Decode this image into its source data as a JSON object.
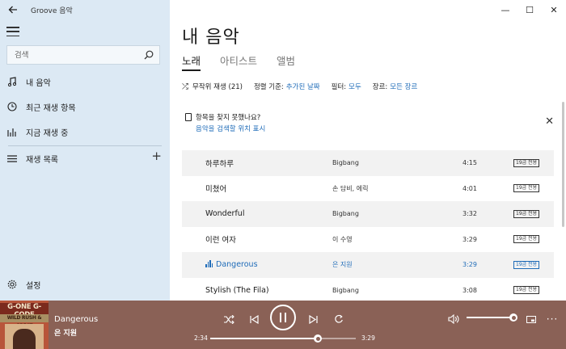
{
  "window": {
    "app_title": "Groove 음악",
    "controls": {
      "minimize": "—",
      "maximize": "☐",
      "close": "✕"
    }
  },
  "sidebar": {
    "search_placeholder": "검색",
    "items": [
      {
        "label": "내 음악",
        "icon": "music-note-icon",
        "active": true
      },
      {
        "label": "최근 재생 항목",
        "icon": "clock-icon"
      },
      {
        "label": "지금 재생 중",
        "icon": "bars-icon"
      },
      {
        "label": "재생 목록",
        "icon": "playlist-icon"
      }
    ],
    "settings_label": "설정"
  },
  "main": {
    "page_title": "내 음악",
    "tabs": [
      {
        "label": "노래",
        "active": true
      },
      {
        "label": "아티스트"
      },
      {
        "label": "앨범"
      }
    ],
    "filter_bar": {
      "shuffle_label": "무작위 재생 (21)",
      "sort_label": "정렬 기준:",
      "sort_value": "추가된 날짜",
      "filter_label": "필터:",
      "filter_value": "모두",
      "genre_label": "장르:",
      "genre_value": "모든 장르"
    },
    "notice": {
      "title": "항목을 찾지 못했나요?",
      "link": "음악을 검색할 위치 표시"
    },
    "songs": [
      {
        "title": "하루하루",
        "artist": "Bigbang",
        "duration": "4:15",
        "badge": "19금 전용"
      },
      {
        "title": "미쳤어",
        "artist": "손 담비, 에릭",
        "duration": "4:01",
        "badge": "19금 전용"
      },
      {
        "title": "Wonderful",
        "artist": "Bigbang",
        "duration": "3:32",
        "badge": "19금 전용"
      },
      {
        "title": "이런 여자",
        "artist": "이 수영",
        "duration": "3:29",
        "badge": "19금 전용"
      },
      {
        "title": "Dangerous",
        "artist": "은 지원",
        "duration": "3:29",
        "badge": "19금 전용",
        "playing": true
      },
      {
        "title": "Stylish (The Fila)",
        "artist": "Bigbang",
        "duration": "3:08",
        "badge": "19금 전용"
      }
    ]
  },
  "player": {
    "album_art_text": [
      "G-ONE G-CODE",
      "WILD RUSH & GREAT"
    ],
    "title": "Dangerous",
    "artist": "은 지원",
    "current_time": "2:34",
    "total_time": "3:29",
    "progress": 0.74,
    "volume": 1.0
  },
  "colors": {
    "sidebar_bg": "#dce9f4",
    "accent": "#1e6bb8",
    "player_bg": "#8a6156"
  }
}
